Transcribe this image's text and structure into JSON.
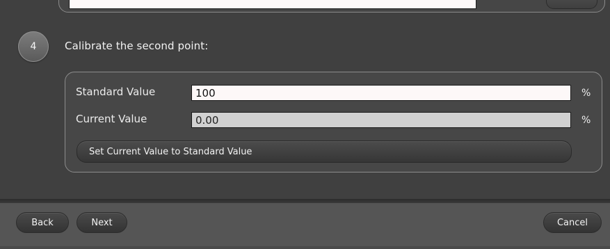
{
  "step": {
    "number": "4",
    "title": "Calibrate the second point:"
  },
  "calibration": {
    "standard_label": "Standard Value",
    "standard_value": "100",
    "standard_unit": "%",
    "current_label": "Current Value",
    "current_value": "0.00",
    "current_unit": "%",
    "set_button_label": "Set Current Value to Standard Value"
  },
  "footer": {
    "back_label": "Back",
    "next_label": "Next",
    "cancel_label": "Cancel"
  }
}
